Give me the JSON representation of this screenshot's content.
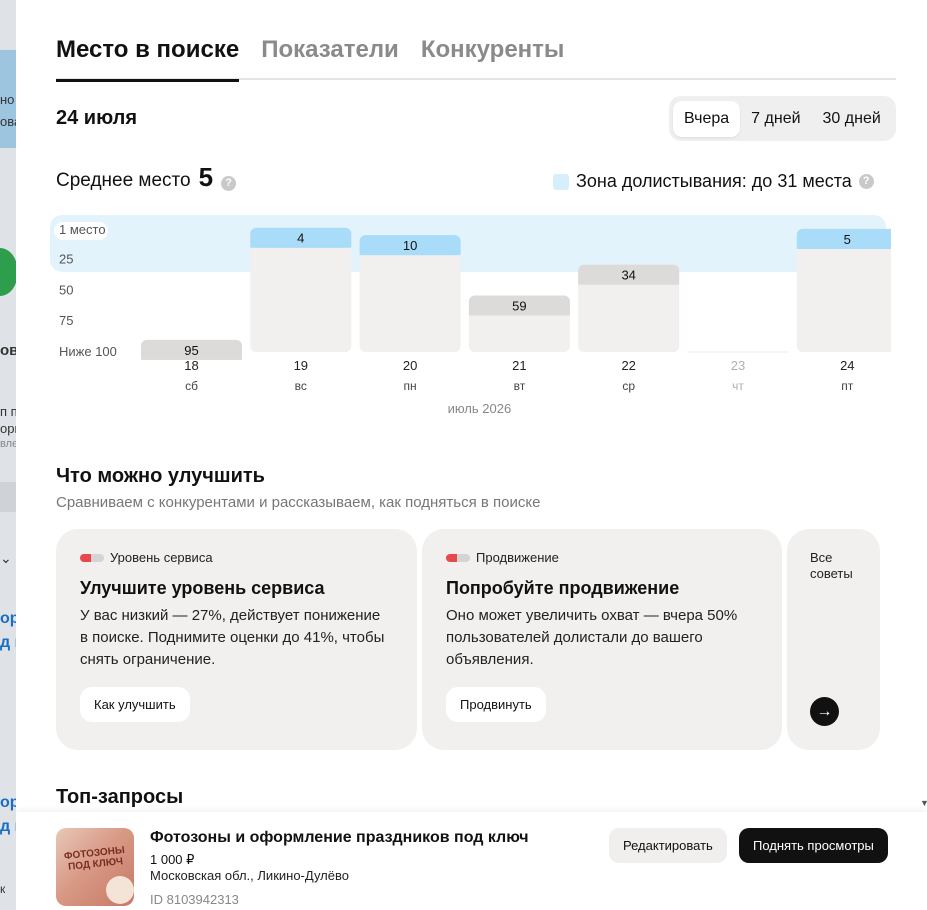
{
  "tabs": [
    {
      "label": "Место в поиске",
      "active": true
    },
    {
      "label": "Показатели",
      "active": false
    },
    {
      "label": "Конкуренты",
      "active": false
    }
  ],
  "date_title": "24 июля",
  "period": {
    "options": [
      "Вчера",
      "7 дней",
      "30 дней"
    ],
    "selected": "Вчера"
  },
  "average": {
    "label": "Среднее место",
    "value": "5"
  },
  "zone": {
    "label": "Зона долистывания: до 31 места",
    "color": "#d7eefb"
  },
  "help_icon": "question-icon",
  "chart_data": {
    "type": "bar",
    "y_reversed": true,
    "y_ticks": [
      "1 место",
      "25",
      "50",
      "75",
      "Ниже 100"
    ],
    "ylim": [
      1,
      100
    ],
    "zone_limit": 31,
    "categories": [
      {
        "day": "18",
        "weekday": "сб"
      },
      {
        "day": "19",
        "weekday": "вс"
      },
      {
        "day": "20",
        "weekday": "пн"
      },
      {
        "day": "21",
        "weekday": "вт"
      },
      {
        "day": "22",
        "weekday": "ср"
      },
      {
        "day": "23",
        "weekday": "чт"
      },
      {
        "day": "24",
        "weekday": "пт"
      }
    ],
    "values": [
      95,
      4,
      10,
      59,
      34,
      null,
      5
    ],
    "xlabel": "июль 2026",
    "colors": {
      "in_zone": "#a8dcf8",
      "out_zone": "#dcdbd9",
      "bar_body": "#f1f0ef",
      "zone_band": "#e2f3fc"
    }
  },
  "improve": {
    "title": "Что можно улучшить",
    "subtitle": "Сравниваем с конкурентами и рассказываем, как подняться в поиске",
    "cards": [
      {
        "tag": "Уровень сервиса",
        "title": "Улучшите уровень сервиса",
        "text": "У вас низкий — 27%, действует понижение в поиске. Поднимите оценки до 41%, чтобы снять ограничение.",
        "button": "Как улучшить",
        "level": 0.27
      },
      {
        "tag": "Продвижение",
        "title": "Попробуйте продвижение",
        "text": "Оно может увеличить охват — вчера 50% пользователей долистали до вашего объявления.",
        "button": "Продвинуть",
        "level": 0.27
      }
    ],
    "more_label": "Все советы",
    "more_icon": "arrow-right-icon"
  },
  "top_queries_title": "Топ-запросы",
  "listing": {
    "title": "Фотозоны и оформление праздников под ключ",
    "price": "1 000 ₽",
    "location": "Московская обл., Ликино-Дулёво",
    "id": "ID 8103942313",
    "thumb_text": "ФОТОЗОНЫ ПОД КЛЮЧ",
    "edit_button": "Редактировать",
    "raise_button": "Поднять просмотры"
  },
  "background_page": {
    "fragments": [
      "но",
      "ова",
      "ов",
      "п пр",
      "орг",
      "вле",
      "ор",
      "д к",
      "ор",
      "д к",
      "к"
    ]
  }
}
